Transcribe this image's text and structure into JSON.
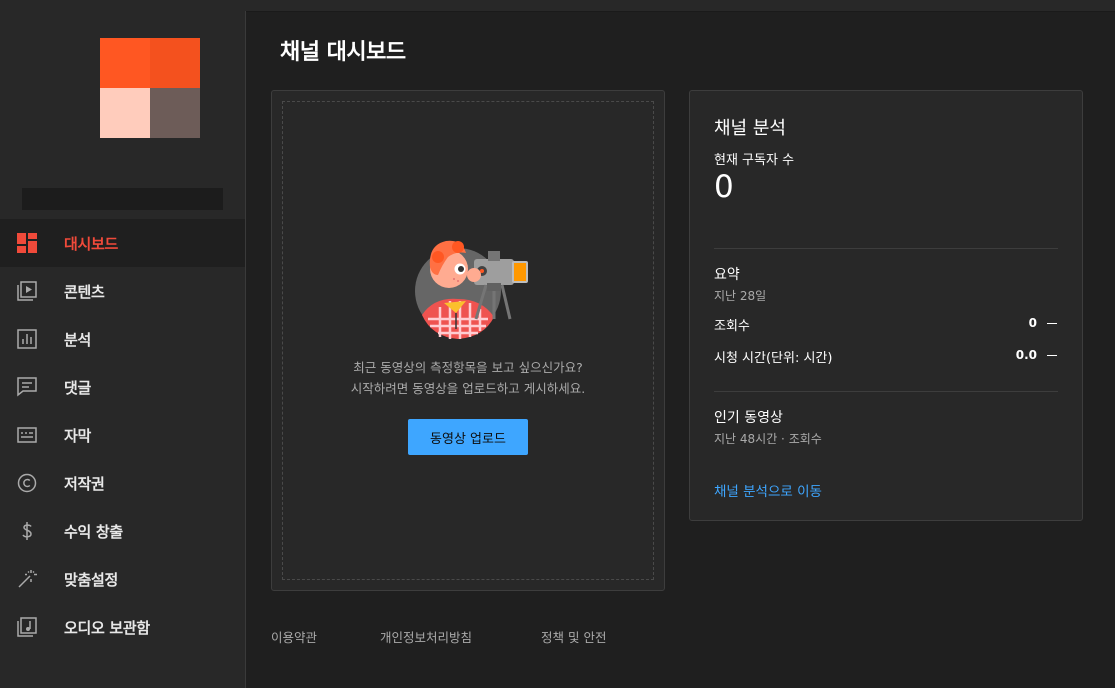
{
  "page_title": "채널 대시보드",
  "channel": {
    "avatar_colors": [
      "#ff5722",
      "#f4511e",
      "#ffccbc",
      "#6d5c58"
    ]
  },
  "sidebar": {
    "items": [
      {
        "label": "대시보드",
        "icon": "dashboard-icon",
        "active": true
      },
      {
        "label": "콘텐츠",
        "icon": "video-library-icon",
        "active": false
      },
      {
        "label": "분석",
        "icon": "analytics-icon",
        "active": false
      },
      {
        "label": "댓글",
        "icon": "comments-icon",
        "active": false
      },
      {
        "label": "자막",
        "icon": "subtitles-icon",
        "active": false
      },
      {
        "label": "저작권",
        "icon": "copyright-icon",
        "active": false
      },
      {
        "label": "수익 창출",
        "icon": "monetization-icon",
        "active": false
      },
      {
        "label": "맞춤설정",
        "icon": "customization-wand-icon",
        "active": false
      },
      {
        "label": "오디오 보관함",
        "icon": "audio-library-icon",
        "active": false
      }
    ]
  },
  "upload_card": {
    "message_line1": "최근 동영상의 측정항목을 보고 싶으신가요?",
    "message_line2": "시작하려면 동영상을 업로드하고 게시하세요.",
    "button_label": "동영상 업로드"
  },
  "analytics_card": {
    "title": "채널 분석",
    "subscribers_label": "현재 구독자 수",
    "subscribers_count": "0",
    "summary_title": "요약",
    "summary_period": "지난 28일",
    "views_label": "조회수",
    "views_value": "0",
    "watch_time_label": "시청 시간(단위: 시간)",
    "watch_time_value": "0.0",
    "top_videos_title": "인기 동영상",
    "top_videos_sub": "지난 48시간 · 조회수",
    "link_label": "채널 분석으로 이동"
  },
  "footer": {
    "terms": "이용약관",
    "privacy": "개인정보처리방침",
    "policy": "정책 및 안전"
  },
  "colors": {
    "accent_red": "#f04a3a",
    "link_blue": "#3ea6ff",
    "background": "#1f1f1f",
    "panel": "#282828"
  }
}
